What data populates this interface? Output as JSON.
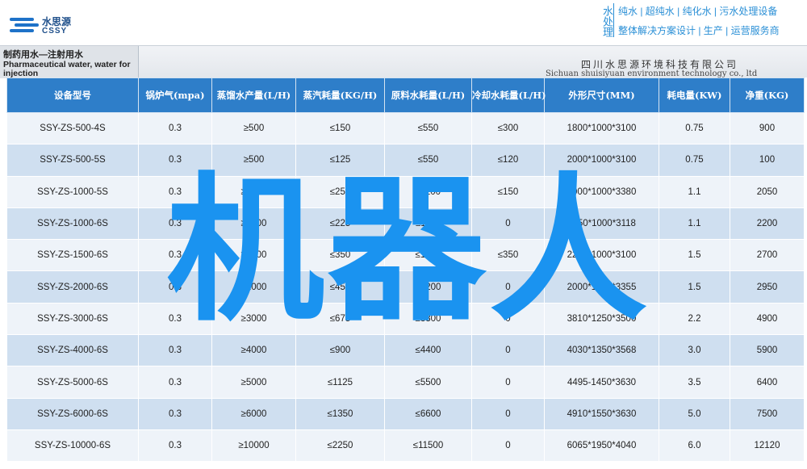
{
  "header": {
    "logo_cn": "水思源",
    "logo_en": "CSSY",
    "brand_vertical": "水处理",
    "brand_line1": "纯水 | 超纯水 | 纯化水 | 污水处理设备",
    "brand_line2": "整体解决方案设计 | 生产 | 运营服务商",
    "accent_color": "#2a8fd6"
  },
  "band": {
    "title_cn": "制药用水—注射用水",
    "title_en": "Pharmaceutical water, water for injection",
    "company_cn": "四川水思源环境科技有限公司",
    "company_en": "Sichuan shuisiyuan environment technology co., ltd"
  },
  "table": {
    "headers": [
      "设备型号",
      "锅炉气(mpa)",
      "蒸馏水产量(L/H)",
      "蒸汽耗量(KG/H)",
      "原料水耗量(L/H)",
      "冷却水耗量(L/H)",
      "外形尺寸(MM)",
      "耗电量(KW)",
      "净重(KG)"
    ],
    "rows": [
      [
        "SSY-ZS-500-4S",
        "0.3",
        "≥500",
        "≤150",
        "≤550",
        "≤300",
        "1800*1000*3100",
        "0.75",
        "900"
      ],
      [
        "SSY-ZS-500-5S",
        "0.3",
        "≥500",
        "≤125",
        "≤550",
        "≤120",
        "2000*1000*3100",
        "0.75",
        "100"
      ],
      [
        "SSY-ZS-1000-5S",
        "0.3",
        "≥1000",
        "≤250",
        "≤1100",
        "≤150",
        "2000*1000*3380",
        "1.1",
        "2050"
      ],
      [
        "SSY-ZS-1000-6S",
        "0.3",
        "≥1000",
        "≤225",
        "≤1100",
        "0",
        "2050*1000*3118",
        "1.1",
        "2200"
      ],
      [
        "SSY-ZS-1500-6S",
        "0.3",
        "≥1500",
        "≤350",
        "≤1650",
        "≤350",
        "2250*1000*3100",
        "1.5",
        "2700"
      ],
      [
        "SSY-ZS-2000-6S",
        "0.3",
        "≥2000",
        "≤450",
        "≤2200",
        "0",
        "2000*1000*3355",
        "1.5",
        "2950"
      ],
      [
        "SSY-ZS-3000-6S",
        "0.3",
        "≥3000",
        "≤675",
        "≤3300",
        "0",
        "3810*1250*3500",
        "2.2",
        "4900"
      ],
      [
        "SSY-ZS-4000-6S",
        "0.3",
        "≥4000",
        "≤900",
        "≤4400",
        "0",
        "4030*1350*3568",
        "3.0",
        "5900"
      ],
      [
        "SSY-ZS-5000-6S",
        "0.3",
        "≥5000",
        "≤1125",
        "≤5500",
        "0",
        "4495-1450*3630",
        "3.5",
        "6400"
      ],
      [
        "SSY-ZS-6000-6S",
        "0.3",
        "≥6000",
        "≤1350",
        "≤6600",
        "0",
        "4910*1550*3630",
        "5.0",
        "7500"
      ],
      [
        "SSY-ZS-10000-6S",
        "0.3",
        "≥10000",
        "≤2250",
        "≤11500",
        "0",
        "6065*1950*4040",
        "6.0",
        "12120"
      ]
    ]
  },
  "watermark": "机器人"
}
